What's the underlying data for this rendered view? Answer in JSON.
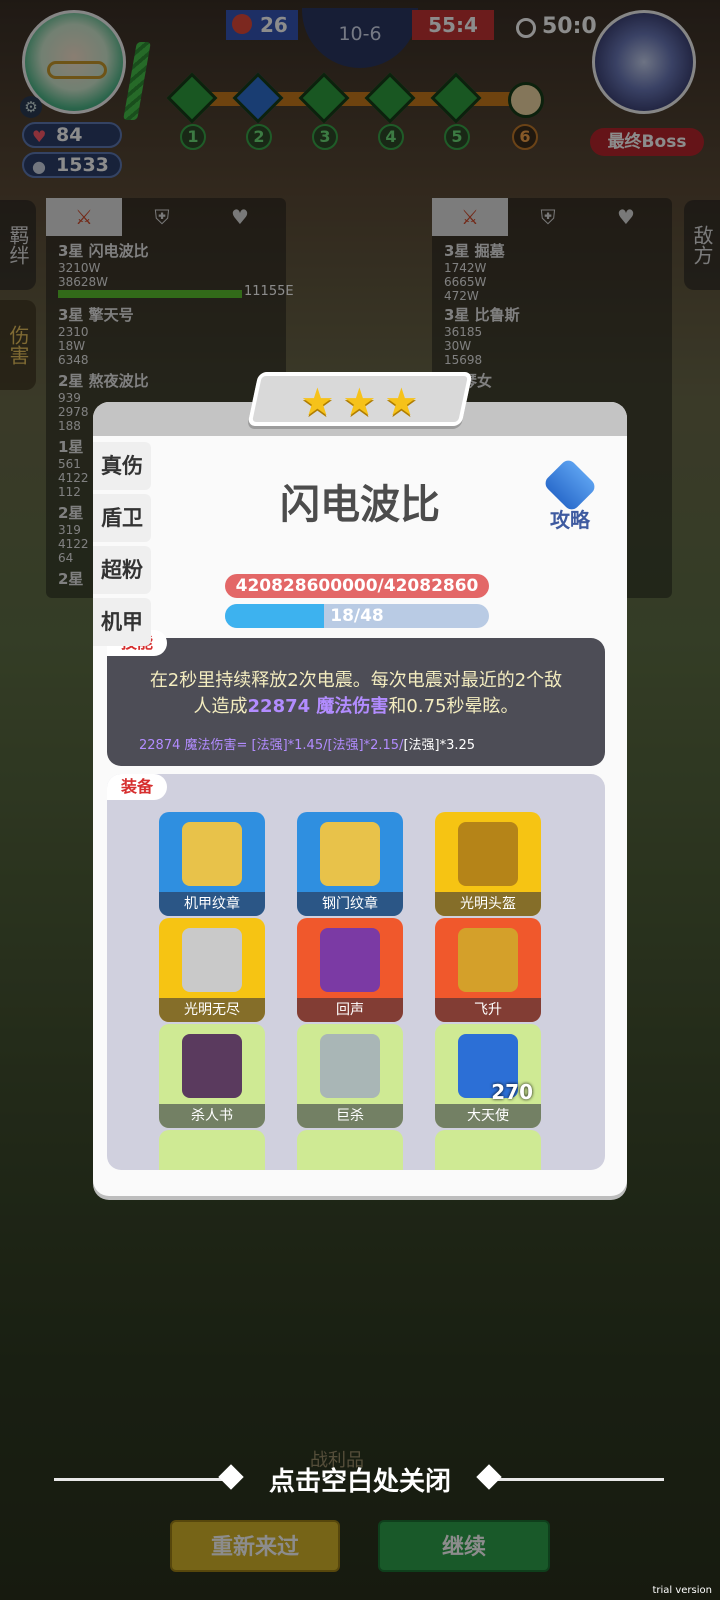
{
  "hud": {
    "hearts": "84",
    "coins": "1533",
    "score_left": "26",
    "round": "10-6",
    "score_right": "55:4",
    "timer": "50:0",
    "boss_label": "最终Boss",
    "stages": [
      "1",
      "2",
      "3",
      "4",
      "5",
      "6"
    ]
  },
  "side_tabs": {
    "bond": "羁绊",
    "damage": "伤害",
    "enemy": "敌方"
  },
  "ally_stats": {
    "rows": [
      {
        "name": "3星 闪电波比",
        "nums": [
          "3210W",
          "38628W"
        ],
        "total": "11155E"
      },
      {
        "name": "3星 擎天号",
        "nums": [
          "2310",
          "18W",
          "6348"
        ]
      },
      {
        "name": "2星 熬夜波比",
        "nums": [
          "939",
          "2978",
          "188"
        ]
      },
      {
        "name": "1星",
        "nums": [
          "561",
          "4122",
          "112"
        ]
      },
      {
        "name": "2星",
        "nums": [
          "319",
          "4122",
          "64"
        ]
      },
      {
        "name": "2星"
      }
    ]
  },
  "enemy_stats": {
    "rows": [
      {
        "name": "3星 掘墓",
        "nums": [
          "1742W",
          "6665W",
          "472W"
        ]
      },
      {
        "name": "3星 比鲁斯",
        "nums": [
          "36185",
          "30W",
          "15698"
        ]
      },
      {
        "name": "琴女"
      }
    ]
  },
  "modal": {
    "stars": 3,
    "class_tabs": [
      "真伤",
      "盾卫",
      "超粉",
      "机甲"
    ],
    "hero_name": "闪电波比",
    "guide_label": "攻略",
    "hp_text": "420828600000/42082860",
    "mp_text": "18/48",
    "mp_fraction": 0.375,
    "skill_tag": "技能",
    "skill_desc_1": "在2秒里持续释放2次电震。每次电震对最近的2个敌",
    "skill_desc_2a": "人造成",
    "skill_desc_2b": "22874 魔法伤害",
    "skill_desc_2c": "和0.75秒晕眩。",
    "formula_a": "22874 魔法伤害= [法强]*1.45/[法强]*2.15/",
    "formula_b": "[法强]*3.25",
    "equip_tag": "装备",
    "equipment": [
      {
        "label": "机甲纹章",
        "color": "blue"
      },
      {
        "label": "钢门纹章",
        "color": "blue"
      },
      {
        "label": "光明头盔",
        "color": "gold"
      },
      {
        "label": "光明无尽",
        "color": "gold"
      },
      {
        "label": "回声",
        "color": "red"
      },
      {
        "label": "飞升",
        "color": "red"
      },
      {
        "label": "杀人书",
        "color": "green"
      },
      {
        "label": "巨杀",
        "color": "green"
      },
      {
        "label": "大天使",
        "color": "green",
        "count": "270"
      }
    ]
  },
  "bottom": {
    "trophy_label": "战利品",
    "close_hint": "点击空白处关闭",
    "retry": "重新来过",
    "continue": "继续",
    "trial": "trial version"
  }
}
